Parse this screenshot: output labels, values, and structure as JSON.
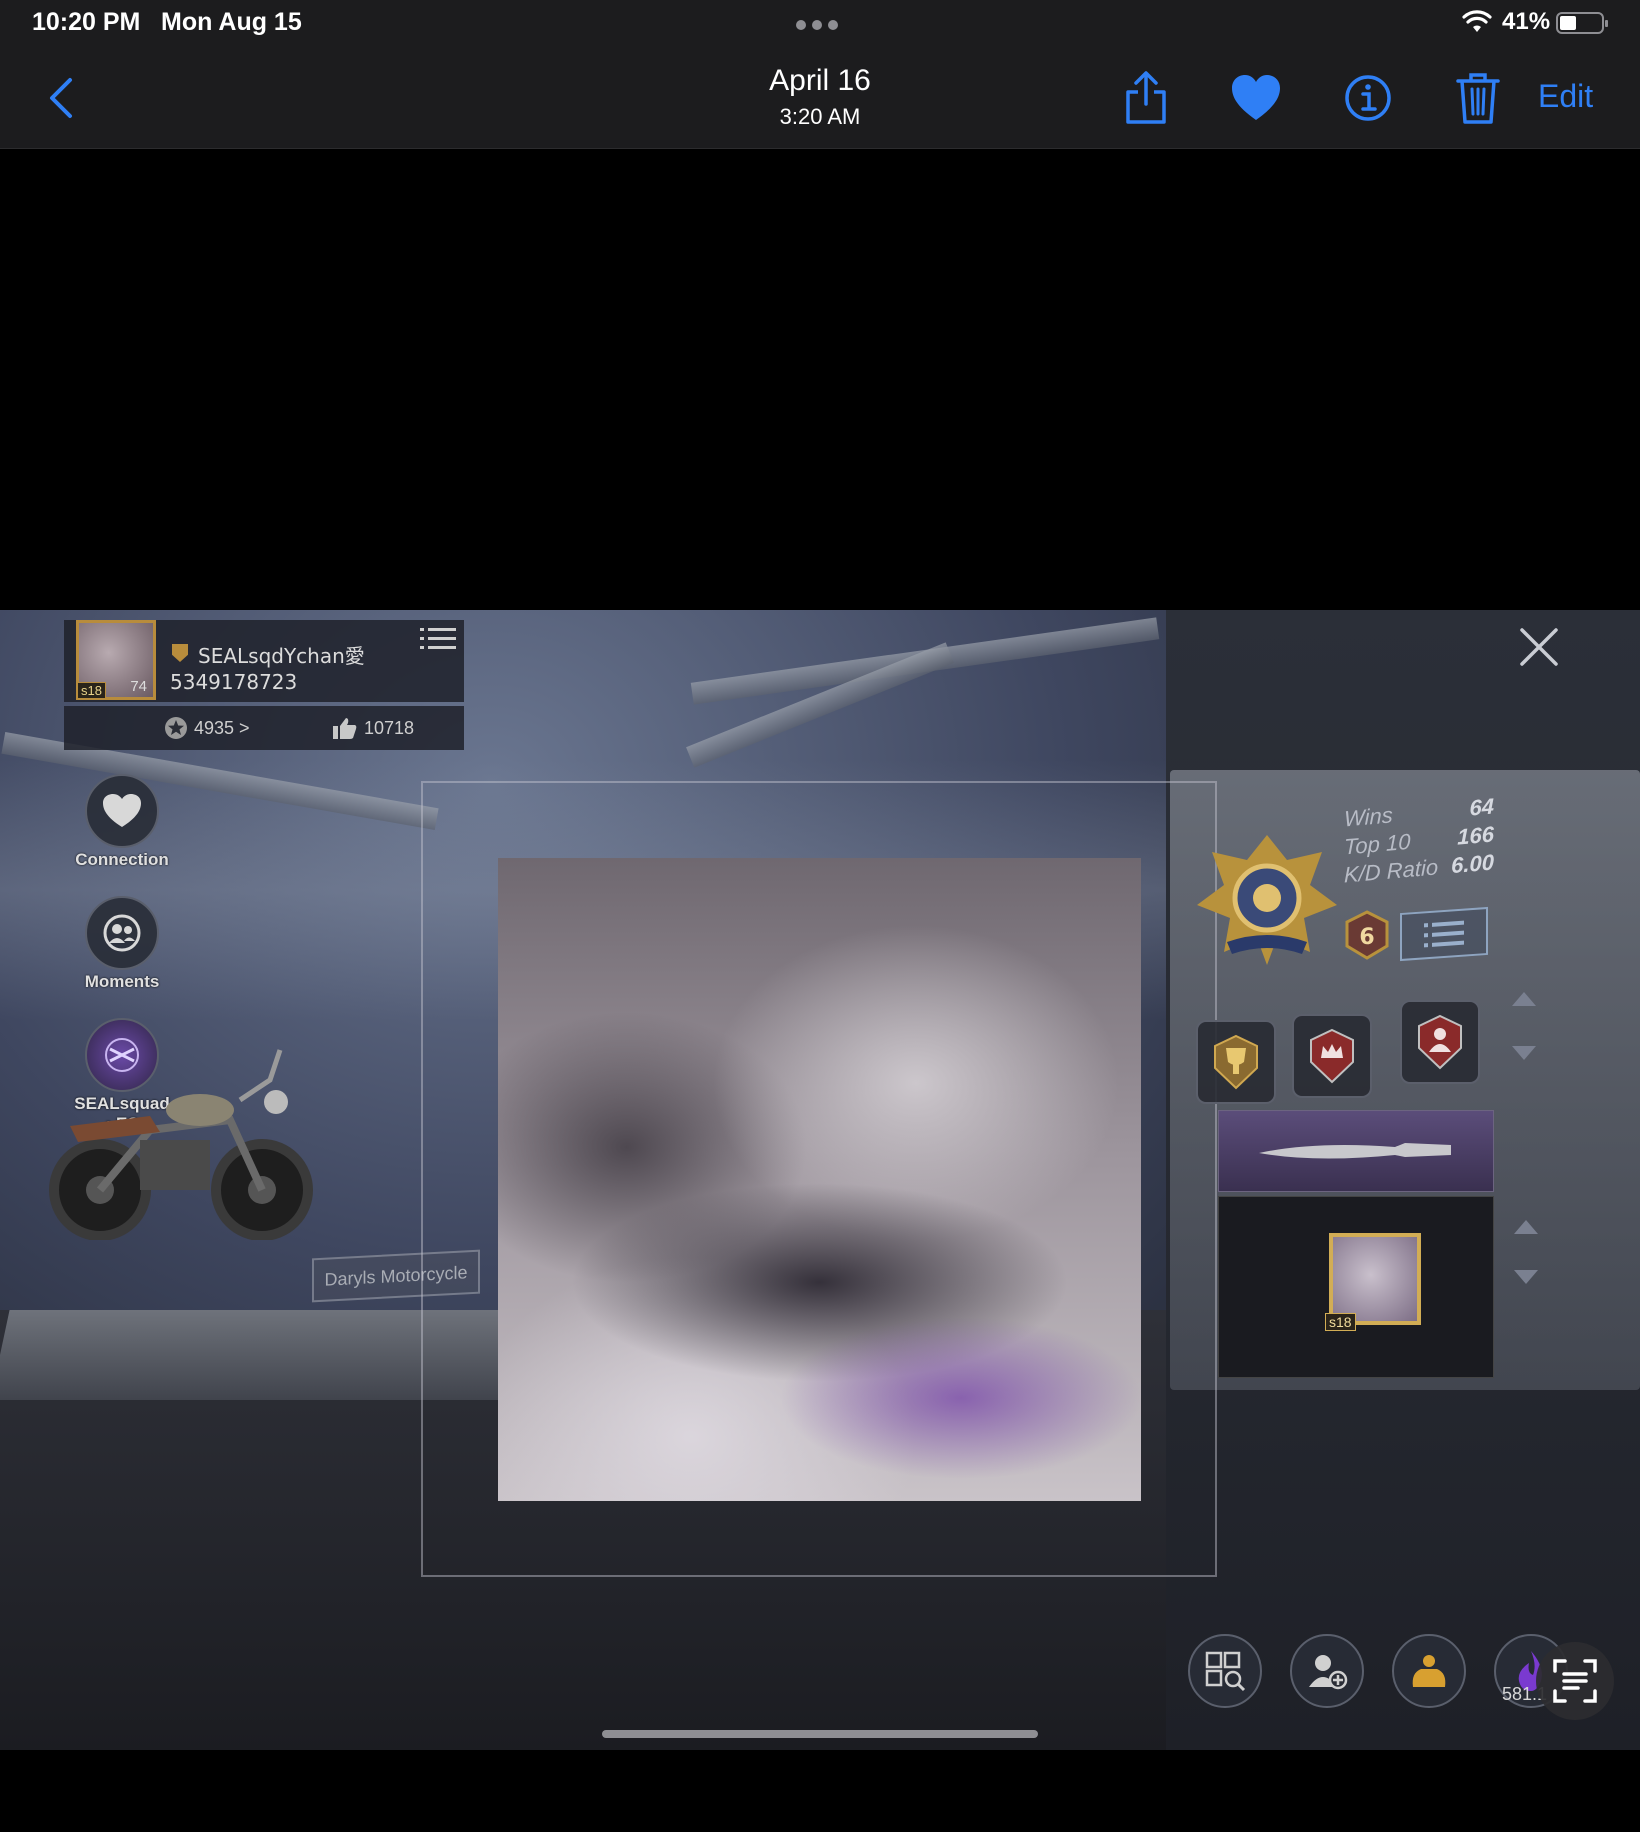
{
  "status_bar": {
    "time": "10:20 PM",
    "date": "Mon Aug 15",
    "battery": "41%"
  },
  "nav": {
    "title": "April 16",
    "subtitle": "3:20 AM",
    "edit_label": "Edit"
  },
  "colors": {
    "accent": "#2f7ff5",
    "bar_bg": "#1c1c1e"
  },
  "game": {
    "player_name": "SEALsqdYchan愛",
    "player_id": "5349178723",
    "avatar_season": "s18",
    "avatar_level": "74",
    "popularity": "4935 >",
    "likes": "10718",
    "side_buttons": [
      {
        "label": "Connection",
        "icon": "heart-icon"
      },
      {
        "label": "Moments",
        "icon": "people-icon"
      },
      {
        "label": "SEALsquad • ES",
        "icon": "clan-logo-icon"
      }
    ],
    "vehicle_label": "Daryls Motorcycle",
    "stats": [
      {
        "label": "Wins",
        "value": "64"
      },
      {
        "label": "Top 10",
        "value": "166"
      },
      {
        "label": "K/D Ratio",
        "value": "6.00"
      }
    ],
    "tier": "6",
    "frame_season": "s18",
    "currency": "581.1"
  }
}
